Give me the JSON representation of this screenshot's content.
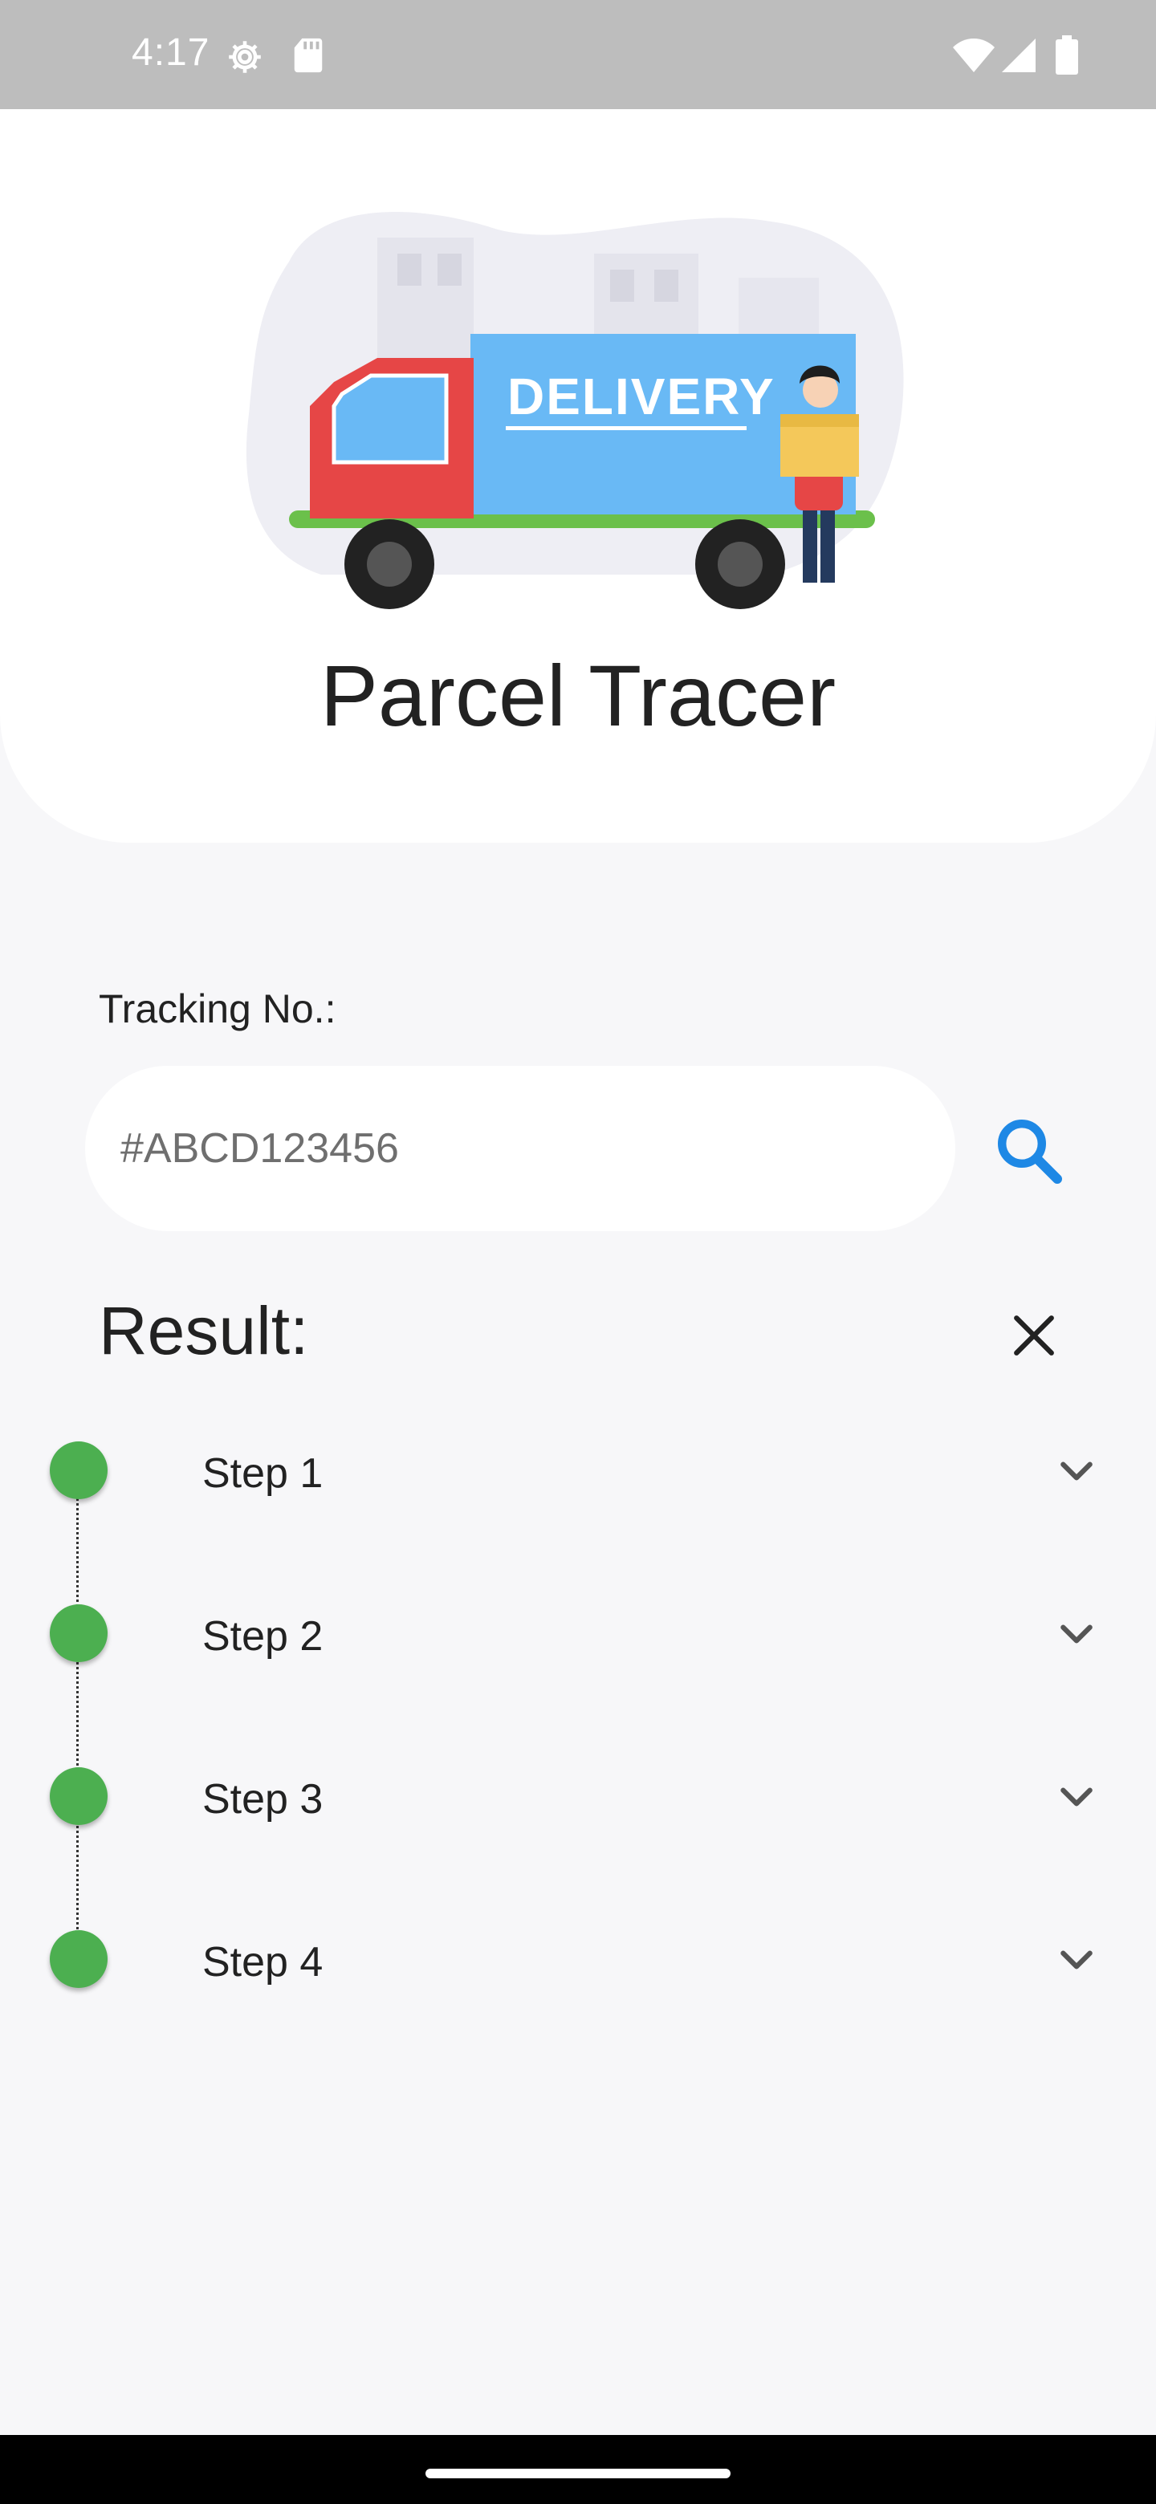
{
  "status_bar": {
    "time": "4:17",
    "left_icons": [
      "settings-icon",
      "sd-card-icon"
    ],
    "right_icons": [
      "wifi-icon",
      "signal-icon",
      "battery-icon"
    ]
  },
  "header": {
    "illustration": "delivery-truck-illustration",
    "truck_text": "DELIVERY",
    "title": "Parcel Tracer"
  },
  "tracking": {
    "label": "Tracking No.:",
    "placeholder": "#ABCD123456",
    "value": "",
    "search_icon": "search-icon",
    "accent_color": "#1e88e5"
  },
  "result": {
    "title": "Result:",
    "close_icon": "close-icon",
    "steps": [
      {
        "label": "Step 1",
        "status_color": "#4caf50"
      },
      {
        "label": "Step 2",
        "status_color": "#4caf50"
      },
      {
        "label": "Step 3",
        "status_color": "#4caf50"
      },
      {
        "label": "Step 4",
        "status_color": "#4caf50"
      }
    ],
    "expand_icon": "chevron-down-icon"
  }
}
